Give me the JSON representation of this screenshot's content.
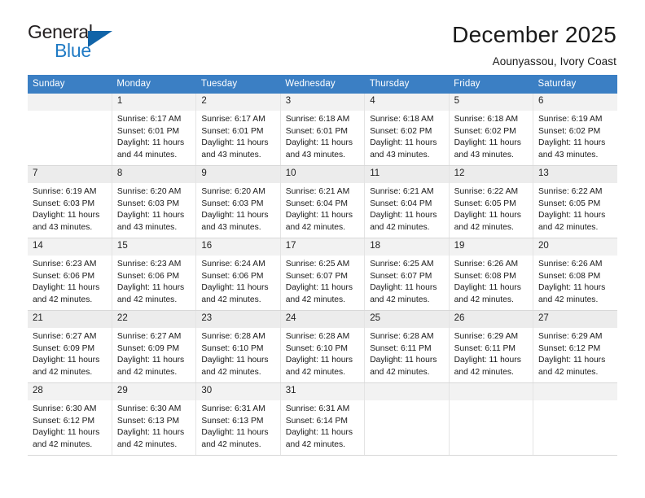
{
  "logo": {
    "word_dark": "General",
    "word_blue": "Blue",
    "triangle_color": "#1164a8",
    "blue_color": "#1f7ac4"
  },
  "header": {
    "title": "December 2025",
    "subtitle": "Aounyassou, Ivory Coast"
  },
  "theme": {
    "header_row_bg": "#3b7fc4",
    "header_text": "#ffffff",
    "daynum_bg": "#f2f2f2",
    "daynum_bg_shaded": "#ececec",
    "grid_line": "#d8d8d8"
  },
  "weekdays": [
    "Sunday",
    "Monday",
    "Tuesday",
    "Wednesday",
    "Thursday",
    "Friday",
    "Saturday"
  ],
  "weeks": [
    {
      "shaded": false,
      "days": [
        {
          "num": "",
          "sunrise": "",
          "sunset": "",
          "daylight_line1": "",
          "daylight_line2": ""
        },
        {
          "num": "1",
          "sunrise": "Sunrise: 6:17 AM",
          "sunset": "Sunset: 6:01 PM",
          "daylight_line1": "Daylight: 11 hours",
          "daylight_line2": "and 44 minutes."
        },
        {
          "num": "2",
          "sunrise": "Sunrise: 6:17 AM",
          "sunset": "Sunset: 6:01 PM",
          "daylight_line1": "Daylight: 11 hours",
          "daylight_line2": "and 43 minutes."
        },
        {
          "num": "3",
          "sunrise": "Sunrise: 6:18 AM",
          "sunset": "Sunset: 6:01 PM",
          "daylight_line1": "Daylight: 11 hours",
          "daylight_line2": "and 43 minutes."
        },
        {
          "num": "4",
          "sunrise": "Sunrise: 6:18 AM",
          "sunset": "Sunset: 6:02 PM",
          "daylight_line1": "Daylight: 11 hours",
          "daylight_line2": "and 43 minutes."
        },
        {
          "num": "5",
          "sunrise": "Sunrise: 6:18 AM",
          "sunset": "Sunset: 6:02 PM",
          "daylight_line1": "Daylight: 11 hours",
          "daylight_line2": "and 43 minutes."
        },
        {
          "num": "6",
          "sunrise": "Sunrise: 6:19 AM",
          "sunset": "Sunset: 6:02 PM",
          "daylight_line1": "Daylight: 11 hours",
          "daylight_line2": "and 43 minutes."
        }
      ]
    },
    {
      "shaded": true,
      "days": [
        {
          "num": "7",
          "sunrise": "Sunrise: 6:19 AM",
          "sunset": "Sunset: 6:03 PM",
          "daylight_line1": "Daylight: 11 hours",
          "daylight_line2": "and 43 minutes."
        },
        {
          "num": "8",
          "sunrise": "Sunrise: 6:20 AM",
          "sunset": "Sunset: 6:03 PM",
          "daylight_line1": "Daylight: 11 hours",
          "daylight_line2": "and 43 minutes."
        },
        {
          "num": "9",
          "sunrise": "Sunrise: 6:20 AM",
          "sunset": "Sunset: 6:03 PM",
          "daylight_line1": "Daylight: 11 hours",
          "daylight_line2": "and 43 minutes."
        },
        {
          "num": "10",
          "sunrise": "Sunrise: 6:21 AM",
          "sunset": "Sunset: 6:04 PM",
          "daylight_line1": "Daylight: 11 hours",
          "daylight_line2": "and 42 minutes."
        },
        {
          "num": "11",
          "sunrise": "Sunrise: 6:21 AM",
          "sunset": "Sunset: 6:04 PM",
          "daylight_line1": "Daylight: 11 hours",
          "daylight_line2": "and 42 minutes."
        },
        {
          "num": "12",
          "sunrise": "Sunrise: 6:22 AM",
          "sunset": "Sunset: 6:05 PM",
          "daylight_line1": "Daylight: 11 hours",
          "daylight_line2": "and 42 minutes."
        },
        {
          "num": "13",
          "sunrise": "Sunrise: 6:22 AM",
          "sunset": "Sunset: 6:05 PM",
          "daylight_line1": "Daylight: 11 hours",
          "daylight_line2": "and 42 minutes."
        }
      ]
    },
    {
      "shaded": false,
      "days": [
        {
          "num": "14",
          "sunrise": "Sunrise: 6:23 AM",
          "sunset": "Sunset: 6:06 PM",
          "daylight_line1": "Daylight: 11 hours",
          "daylight_line2": "and 42 minutes."
        },
        {
          "num": "15",
          "sunrise": "Sunrise: 6:23 AM",
          "sunset": "Sunset: 6:06 PM",
          "daylight_line1": "Daylight: 11 hours",
          "daylight_line2": "and 42 minutes."
        },
        {
          "num": "16",
          "sunrise": "Sunrise: 6:24 AM",
          "sunset": "Sunset: 6:06 PM",
          "daylight_line1": "Daylight: 11 hours",
          "daylight_line2": "and 42 minutes."
        },
        {
          "num": "17",
          "sunrise": "Sunrise: 6:25 AM",
          "sunset": "Sunset: 6:07 PM",
          "daylight_line1": "Daylight: 11 hours",
          "daylight_line2": "and 42 minutes."
        },
        {
          "num": "18",
          "sunrise": "Sunrise: 6:25 AM",
          "sunset": "Sunset: 6:07 PM",
          "daylight_line1": "Daylight: 11 hours",
          "daylight_line2": "and 42 minutes."
        },
        {
          "num": "19",
          "sunrise": "Sunrise: 6:26 AM",
          "sunset": "Sunset: 6:08 PM",
          "daylight_line1": "Daylight: 11 hours",
          "daylight_line2": "and 42 minutes."
        },
        {
          "num": "20",
          "sunrise": "Sunrise: 6:26 AM",
          "sunset": "Sunset: 6:08 PM",
          "daylight_line1": "Daylight: 11 hours",
          "daylight_line2": "and 42 minutes."
        }
      ]
    },
    {
      "shaded": true,
      "days": [
        {
          "num": "21",
          "sunrise": "Sunrise: 6:27 AM",
          "sunset": "Sunset: 6:09 PM",
          "daylight_line1": "Daylight: 11 hours",
          "daylight_line2": "and 42 minutes."
        },
        {
          "num": "22",
          "sunrise": "Sunrise: 6:27 AM",
          "sunset": "Sunset: 6:09 PM",
          "daylight_line1": "Daylight: 11 hours",
          "daylight_line2": "and 42 minutes."
        },
        {
          "num": "23",
          "sunrise": "Sunrise: 6:28 AM",
          "sunset": "Sunset: 6:10 PM",
          "daylight_line1": "Daylight: 11 hours",
          "daylight_line2": "and 42 minutes."
        },
        {
          "num": "24",
          "sunrise": "Sunrise: 6:28 AM",
          "sunset": "Sunset: 6:10 PM",
          "daylight_line1": "Daylight: 11 hours",
          "daylight_line2": "and 42 minutes."
        },
        {
          "num": "25",
          "sunrise": "Sunrise: 6:28 AM",
          "sunset": "Sunset: 6:11 PM",
          "daylight_line1": "Daylight: 11 hours",
          "daylight_line2": "and 42 minutes."
        },
        {
          "num": "26",
          "sunrise": "Sunrise: 6:29 AM",
          "sunset": "Sunset: 6:11 PM",
          "daylight_line1": "Daylight: 11 hours",
          "daylight_line2": "and 42 minutes."
        },
        {
          "num": "27",
          "sunrise": "Sunrise: 6:29 AM",
          "sunset": "Sunset: 6:12 PM",
          "daylight_line1": "Daylight: 11 hours",
          "daylight_line2": "and 42 minutes."
        }
      ]
    },
    {
      "shaded": false,
      "days": [
        {
          "num": "28",
          "sunrise": "Sunrise: 6:30 AM",
          "sunset": "Sunset: 6:12 PM",
          "daylight_line1": "Daylight: 11 hours",
          "daylight_line2": "and 42 minutes."
        },
        {
          "num": "29",
          "sunrise": "Sunrise: 6:30 AM",
          "sunset": "Sunset: 6:13 PM",
          "daylight_line1": "Daylight: 11 hours",
          "daylight_line2": "and 42 minutes."
        },
        {
          "num": "30",
          "sunrise": "Sunrise: 6:31 AM",
          "sunset": "Sunset: 6:13 PM",
          "daylight_line1": "Daylight: 11 hours",
          "daylight_line2": "and 42 minutes."
        },
        {
          "num": "31",
          "sunrise": "Sunrise: 6:31 AM",
          "sunset": "Sunset: 6:14 PM",
          "daylight_line1": "Daylight: 11 hours",
          "daylight_line2": "and 42 minutes."
        },
        {
          "num": "",
          "sunrise": "",
          "sunset": "",
          "daylight_line1": "",
          "daylight_line2": ""
        },
        {
          "num": "",
          "sunrise": "",
          "sunset": "",
          "daylight_line1": "",
          "daylight_line2": ""
        },
        {
          "num": "",
          "sunrise": "",
          "sunset": "",
          "daylight_line1": "",
          "daylight_line2": ""
        }
      ]
    }
  ]
}
